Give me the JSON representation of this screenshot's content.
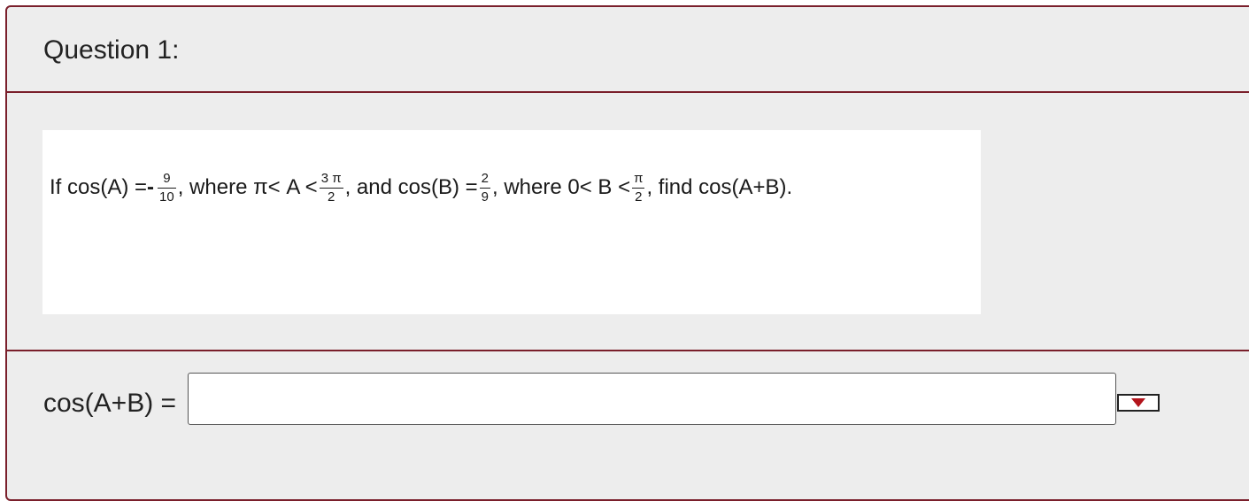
{
  "question": {
    "title": "Question 1:"
  },
  "problem": {
    "text_if": "If cos(A) = ",
    "neg_sign": "-",
    "fracA_num": "9",
    "fracA_den": "10",
    "text_where1": ", where π< A < ",
    "fracB_num": "3 π",
    "fracB_den": "2",
    "text_and": ", and cos(B) = ",
    "fracC_num": "2",
    "fracC_den": "9",
    "text_where2": ", where 0< B < ",
    "fracD_num": "π",
    "fracD_den": "2",
    "text_find": ", find cos(A+B)."
  },
  "answer": {
    "label": "cos(A+B) =",
    "value": "",
    "placeholder": ""
  },
  "colors": {
    "accent_border": "#7a1f2b",
    "dropdown_arrow": "#b3141c",
    "panel_background": "#ededed"
  },
  "icons": {
    "dropdown": "dropdown-arrow-icon"
  }
}
